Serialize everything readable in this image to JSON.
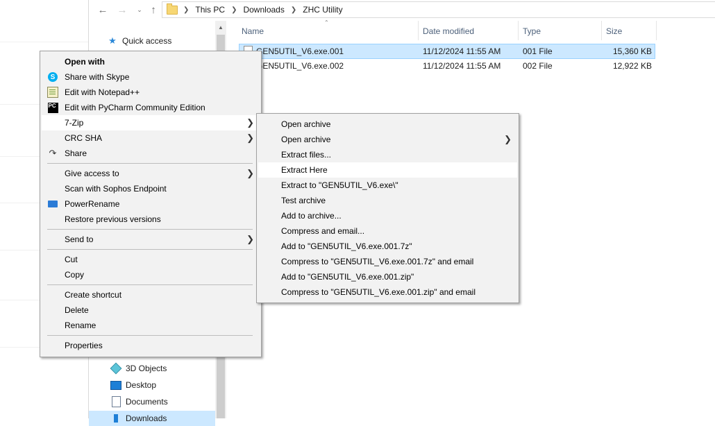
{
  "breadcrumb": [
    "This PC",
    "Downloads",
    "ZHC Utility"
  ],
  "nav": {
    "quick_access": "Quick access",
    "items": [
      {
        "label": "3D Objects",
        "icon": "cube-icon"
      },
      {
        "label": "Desktop",
        "icon": "desktop-icon"
      },
      {
        "label": "Documents",
        "icon": "documents-icon"
      },
      {
        "label": "Downloads",
        "icon": "downloads-icon"
      }
    ]
  },
  "columns": {
    "name": "Name",
    "date": "Date modified",
    "type": "Type",
    "size": "Size"
  },
  "files": [
    {
      "name": "GEN5UTIL_V6.exe.001",
      "date": "11/12/2024 11:55 AM",
      "type": "001 File",
      "size": "15,360 KB",
      "selected": true
    },
    {
      "name": "GEN5UTIL_V6.exe.002",
      "date": "11/12/2024 11:55 AM",
      "type": "002 File",
      "size": "12,922 KB",
      "selected": false
    }
  ],
  "context_menu": {
    "open_with": "Open with",
    "share_skype": "Share with Skype",
    "edit_npp": "Edit with Notepad++",
    "edit_pycharm": "Edit with PyCharm Community Edition",
    "seven_zip": "7-Zip",
    "crc_sha": "CRC SHA",
    "share": "Share",
    "give_access": "Give access to",
    "sophos": "Scan with Sophos Endpoint",
    "power_rename": "PowerRename",
    "restore": "Restore previous versions",
    "send_to": "Send to",
    "cut": "Cut",
    "copy": "Copy",
    "create_shortcut": "Create shortcut",
    "delete": "Delete",
    "rename": "Rename",
    "properties": "Properties"
  },
  "submenu": {
    "items": [
      "Open archive",
      "Open archive",
      "Extract files...",
      "Extract Here",
      "Extract to \"GEN5UTIL_V6.exe\\\"",
      "Test archive",
      "Add to archive...",
      "Compress and email...",
      "Add to \"GEN5UTIL_V6.exe.001.7z\"",
      "Compress to \"GEN5UTIL_V6.exe.001.7z\" and email",
      "Add to \"GEN5UTIL_V6.exe.001.zip\"",
      "Compress to \"GEN5UTIL_V6.exe.001.zip\" and email"
    ]
  }
}
